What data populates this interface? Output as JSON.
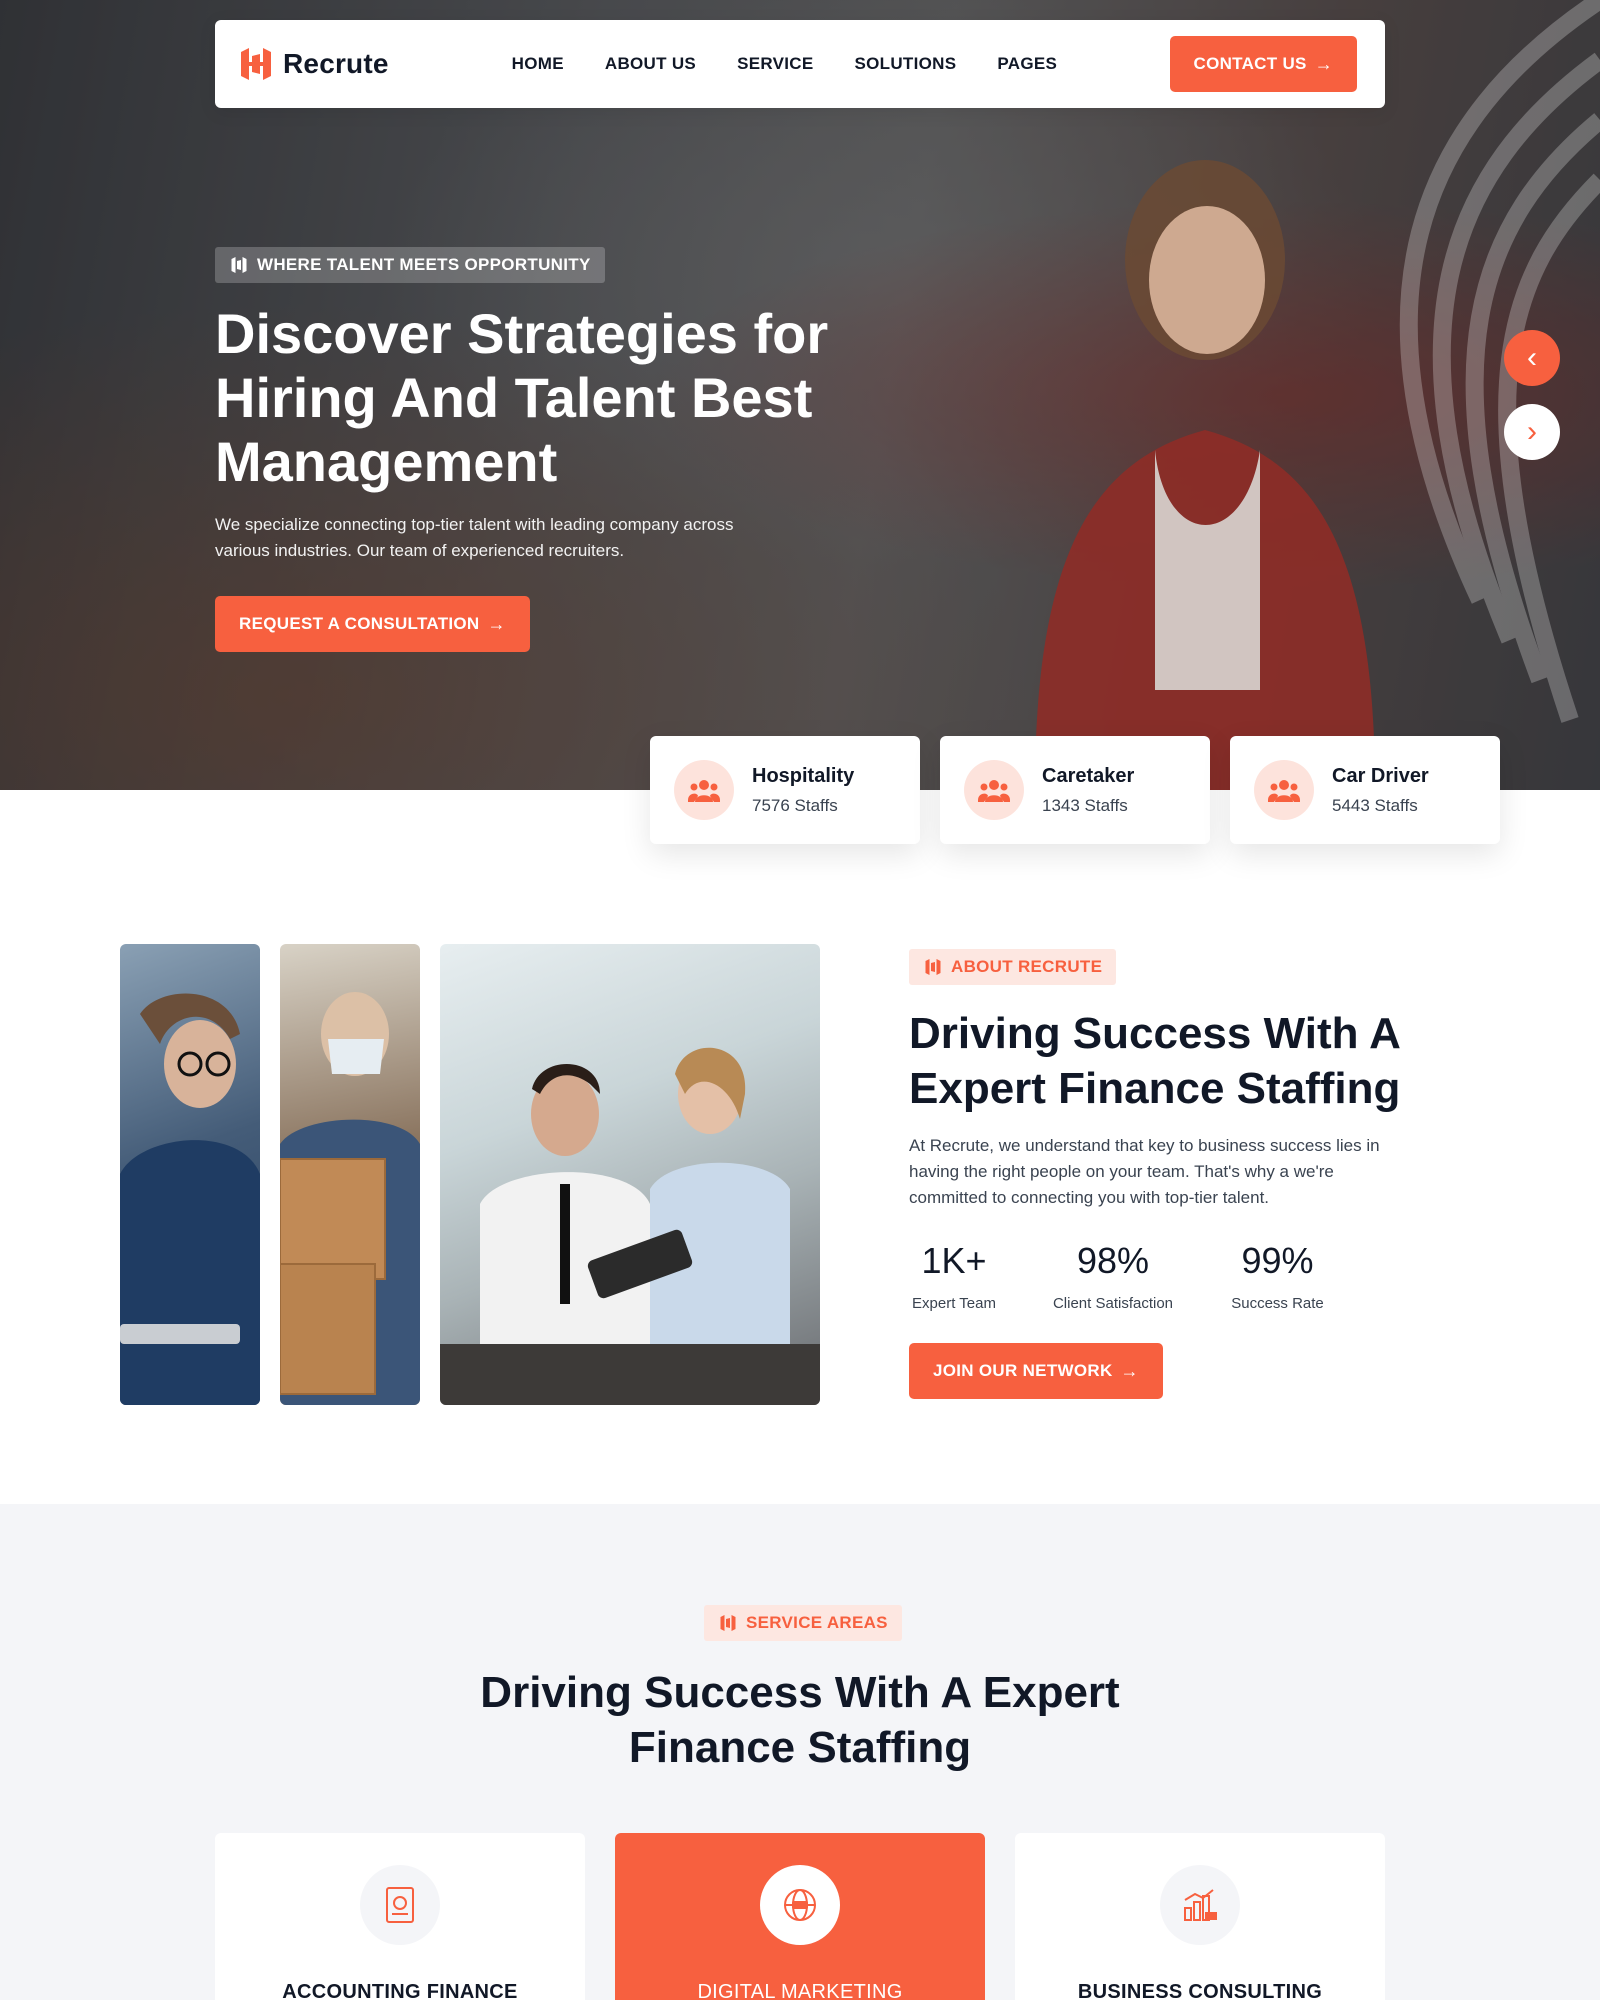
{
  "brand": {
    "name": "Recrute",
    "accent_color": "#f7603f"
  },
  "nav": {
    "items": [
      "HOME",
      "ABOUT US",
      "SERVICE",
      "SOLUTIONS",
      "PAGES"
    ],
    "cta_label": "CONTACT US"
  },
  "hero": {
    "tag": "WHERE TALENT MEETS OPPORTUNITY",
    "title": "Discover Strategies for Hiring And Talent Best Management",
    "description": "We specialize connecting top-tier talent with leading company across various industries. Our team of experienced recruiters.",
    "cta_label": "REQUEST A CONSULTATION",
    "slider_prev_icon": "chevron-left-icon",
    "slider_next_icon": "chevron-right-icon"
  },
  "categories": [
    {
      "name": "Hospitality",
      "count": "7576 Staffs",
      "icon": "users-icon"
    },
    {
      "name": "Caretaker",
      "count": "1343 Staffs",
      "icon": "users-icon"
    },
    {
      "name": "Car Driver",
      "count": "5443 Staffs",
      "icon": "users-icon"
    }
  ],
  "about": {
    "tag": "ABOUT RECRUTE",
    "title": "Driving Success With A Expert Finance Staffing",
    "description": "At Recrute, we understand that key to business success lies in having the right people on your team. That's why a we're committed to connecting you with top-tier talent.",
    "stats": [
      {
        "value": "1K+",
        "label": "Expert Team"
      },
      {
        "value": "98%",
        "label": "Client Satisfaction"
      },
      {
        "value": "99%",
        "label": "Success Rate"
      }
    ],
    "cta_label": "JOIN OUR NETWORK"
  },
  "services": {
    "tag": "SERVICE AREAS",
    "title": "Driving Success With A Expert Finance Staffing",
    "cards": [
      {
        "name": "ACCOUNTING FINANCE",
        "icon": "accounting-document-icon",
        "active": false
      },
      {
        "name": "DIGITAL MARKETING",
        "icon": "seo-globe-icon",
        "active": true
      },
      {
        "name": "BUSINESS CONSULTING",
        "icon": "bar-chart-icon",
        "active": false
      }
    ]
  }
}
